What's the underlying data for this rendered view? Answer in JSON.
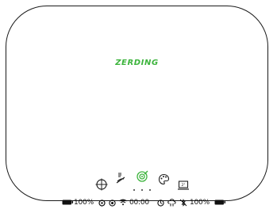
{
  "brand": {
    "logo_text": "ZERDING",
    "accent_color": "#3db43d"
  },
  "modes": [
    {
      "name": "crosshair-mode",
      "icon": "crosshair-circle-icon",
      "active": false
    },
    {
      "name": "wifi-off-mode",
      "icon": "wifi-off-icon",
      "active": false
    },
    {
      "name": "target-mode",
      "icon": "target-icon",
      "active": true
    },
    {
      "name": "palette-mode",
      "icon": "palette-icon",
      "active": false
    },
    {
      "name": "screen-mode",
      "icon": "monitor-icon",
      "active": false
    }
  ],
  "page_indicator": {
    "count": 3
  },
  "status": {
    "battery_left": "100%",
    "time": "00:00",
    "battery_right": "100%"
  }
}
